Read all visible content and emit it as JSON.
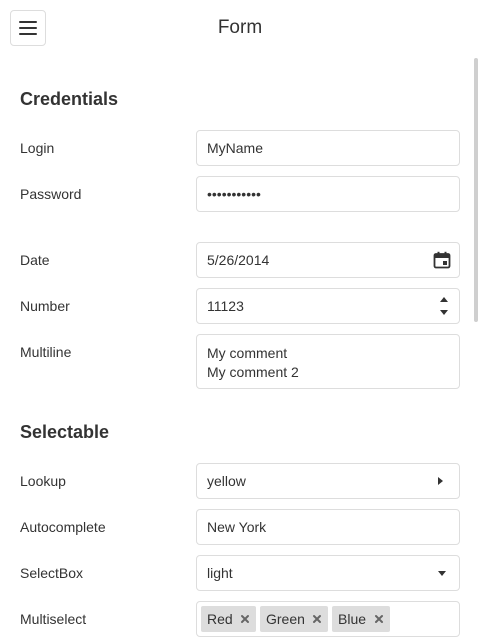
{
  "header": {
    "title": "Form",
    "menu_icon": "hamburger-icon"
  },
  "credentials": {
    "section_title": "Credentials",
    "login": {
      "label": "Login",
      "value": "MyName"
    },
    "password": {
      "label": "Password",
      "value": "•••••••••••"
    }
  },
  "details": {
    "date": {
      "label": "Date",
      "value": "5/26/2014",
      "icon": "calendar-icon"
    },
    "number": {
      "label": "Number",
      "value": "11123"
    },
    "multiline": {
      "label": "Multiline",
      "lines": [
        "My comment",
        "My comment 2"
      ]
    }
  },
  "selectable": {
    "section_title": "Selectable",
    "lookup": {
      "label": "Lookup",
      "value": "yellow"
    },
    "autocomplete": {
      "label": "Autocomplete",
      "value": "New York"
    },
    "selectbox": {
      "label": "SelectBox",
      "value": "light"
    },
    "multiselect": {
      "label": "Multiselect",
      "tags": [
        "Red",
        "Green",
        "Blue"
      ]
    }
  },
  "colors": {
    "text": "#333333",
    "border": "#dddddd",
    "tag_bg": "#dddddd"
  }
}
